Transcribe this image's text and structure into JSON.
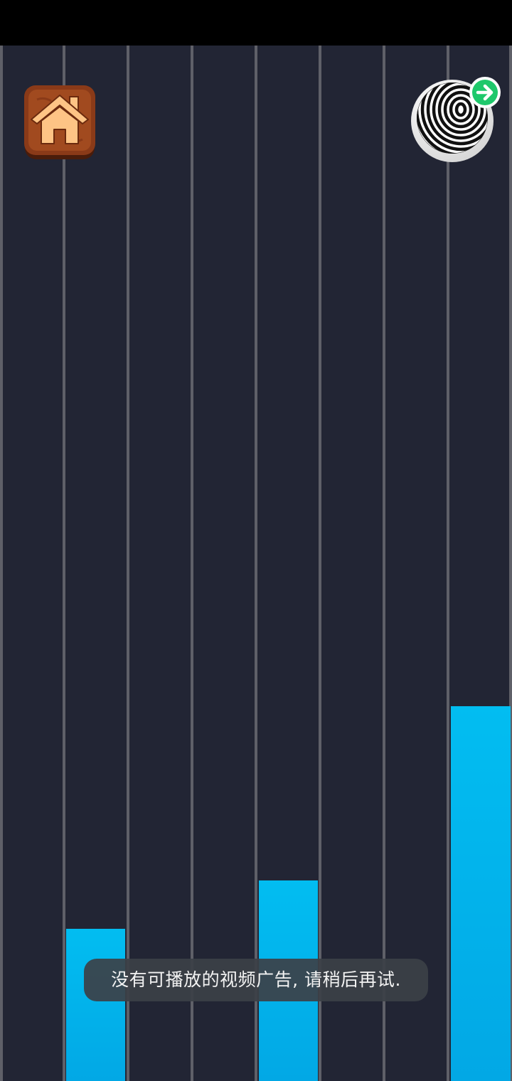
{
  "colors": {
    "background": "#222534",
    "lane_divider": "#5f6068",
    "bar": "#02b4ec",
    "home_tile": "#8a3a18",
    "home_house": "#fec485",
    "badge": "#1ec86b"
  },
  "icons": {
    "home": "home-icon",
    "ball": "striped-ball-icon",
    "next": "arrow-right-icon"
  },
  "bars": [
    {
      "lane": 2,
      "level": 0.147
    },
    {
      "lane": 5,
      "level": 0.194
    },
    {
      "lane": 8,
      "level": 0.362
    }
  ],
  "toast": {
    "message": "没有可播放的视频广告, 请稍后再试."
  }
}
